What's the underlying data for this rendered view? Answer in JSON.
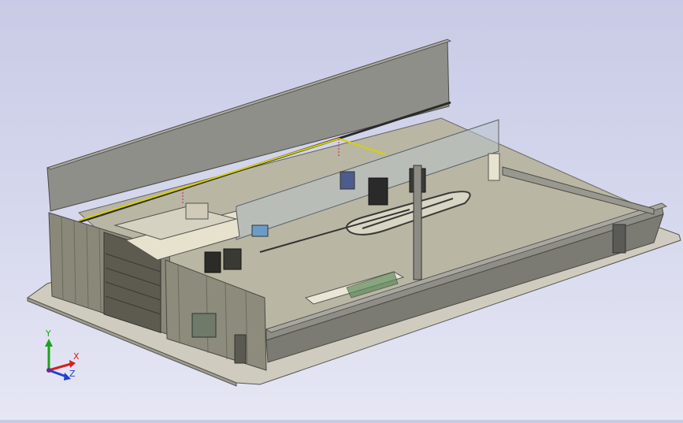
{
  "triad": {
    "x_label": "X",
    "y_label": "Y",
    "z_label": "Z"
  },
  "colors": {
    "background_top": "#c9cbe6",
    "background_bottom": "#e6e7f4",
    "wall_gray": "#8c8c86",
    "floor": "#b8b4a2",
    "triad_x": "#d42020",
    "triad_y": "#20a020",
    "triad_z": "#2040d0",
    "beam_yellow": "#d8d000"
  }
}
